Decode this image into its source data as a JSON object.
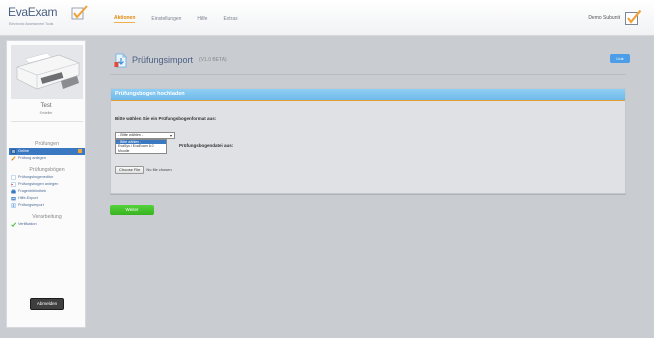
{
  "header": {
    "logo_text": "EvaExam",
    "logo_subtitle": "Electronic Assessment Tools",
    "nav": [
      {
        "label": "Aktionen",
        "active": true
      },
      {
        "label": "Einstellungen",
        "active": false
      },
      {
        "label": "Hilfe",
        "active": false
      },
      {
        "label": "Extras",
        "active": false
      }
    ],
    "user_name": "Demo Subunit"
  },
  "sidebar": {
    "user_name": "Test",
    "user_role": "Ersteller",
    "sections": [
      {
        "heading": "Prüfungen",
        "items": [
          {
            "label": "Online",
            "icon": "list-icon",
            "active": true
          },
          {
            "label": "Prüfung anlegen",
            "icon": "pencil-icon",
            "active": false
          }
        ]
      },
      {
        "heading": "Prüfungsbögen",
        "items": [
          {
            "label": "Prüfungsbogeneditor",
            "icon": "document-icon",
            "active": false
          },
          {
            "label": "Prüfungsbogen anlegen",
            "icon": "document-add-icon",
            "active": false
          },
          {
            "label": "Fragenbibliothek",
            "icon": "library-icon",
            "active": false
          },
          {
            "label": "Hilfe-Export",
            "icon": "export-icon",
            "active": false
          },
          {
            "label": "Prüfungsimport",
            "icon": "import-icon",
            "active": false
          }
        ]
      },
      {
        "heading": "Verarbeitung",
        "items": [
          {
            "label": "Verifikation",
            "icon": "check-icon",
            "active": false
          }
        ]
      }
    ],
    "logout_label": "Abmelden"
  },
  "main": {
    "page_title": "Prüfungsimport",
    "page_version": "(V1.0 BETA)",
    "link_label": "Link",
    "panel_title": "Prüfungsbogen hochladen",
    "format_label": "Bitte wählen Sie ein Prüfungsbogenformat aus:",
    "select_value": "- Bitte wählen -",
    "select_options": [
      "- Bitte wählen -",
      "EvaSys / EvaExam 6.0",
      "Moodle"
    ],
    "file_label": "Prüfungsbogendatei aus:",
    "choose_file_label": "Choose File",
    "no_file_label": "No file chosen",
    "next_label": "Weiter"
  },
  "colors": {
    "accent_orange": "#e08a10",
    "panel_header_blue": "#6fb9ea",
    "next_green": "#37b321",
    "active_blue": "#3a78c2"
  }
}
